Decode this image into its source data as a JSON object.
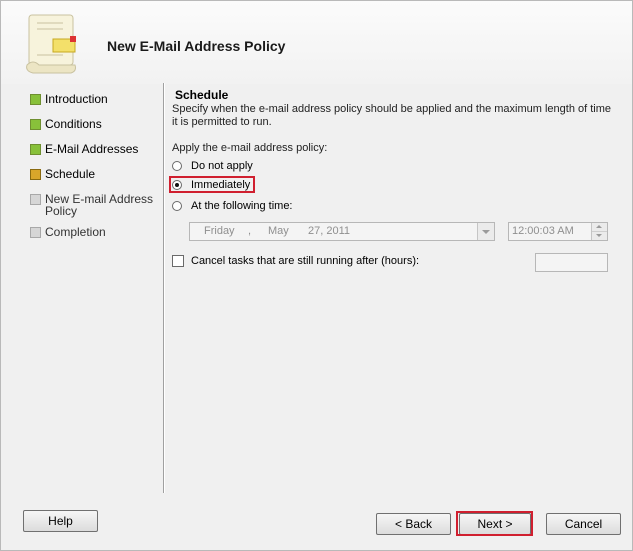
{
  "window": {
    "title": "New E-Mail Address Policy",
    "icon": "scroll-document-icon"
  },
  "nav": {
    "items": [
      {
        "label": "Introduction",
        "state": "completed"
      },
      {
        "label": "Conditions",
        "state": "completed"
      },
      {
        "label": "E-Mail Addresses",
        "state": "completed"
      },
      {
        "label": "Schedule",
        "state": "current"
      },
      {
        "label": "New E-mail Address Policy",
        "state": "pending"
      },
      {
        "label": "Completion",
        "state": "pending"
      }
    ]
  },
  "schedule": {
    "title": "Schedule",
    "description": "Specify when the e-mail address policy should be applied and the maximum length of time it is permitted to run.",
    "apply_label": "Apply the e-mail address policy:",
    "options": [
      {
        "label": "Do not apply",
        "checked": false
      },
      {
        "label": "Immediately",
        "checked": true
      },
      {
        "label": "At the following time:",
        "checked": false
      }
    ],
    "date": {
      "weekday": "Friday",
      "sep": ",",
      "month": "May",
      "day_year": "27, 2011"
    },
    "time": "12:00:03 AM",
    "cancel_tasks_label": "Cancel tasks that are still running after (hours):",
    "cancel_tasks_checked": false,
    "hours_value": ""
  },
  "buttons": {
    "help": "Help",
    "back": "< Back",
    "next": "Next >",
    "cancel": "Cancel"
  },
  "colors": {
    "highlight": "#d01f2f",
    "completed_step": "#88c13a",
    "current_step": "#d9a62a",
    "pending_step": "#d6d6d6"
  }
}
